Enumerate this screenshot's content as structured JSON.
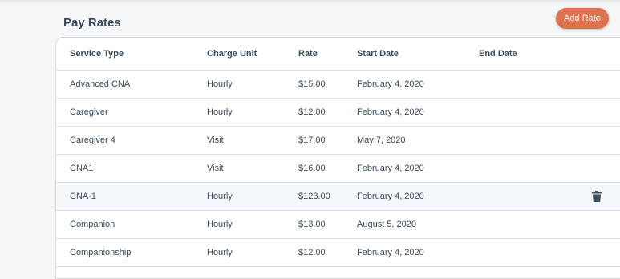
{
  "section": {
    "title": "Pay Rates",
    "add_button": "Add Rate"
  },
  "table": {
    "columns": [
      "Service Type",
      "Charge Unit",
      "Rate",
      "Start Date",
      "End Date"
    ],
    "rows": [
      {
        "service_type": "Advanced CNA",
        "charge_unit": "Hourly",
        "rate": "$15.00",
        "start_date": "February 4, 2020",
        "end_date": ""
      },
      {
        "service_type": "Caregiver",
        "charge_unit": "Hourly",
        "rate": "$12.00",
        "start_date": "February 4, 2020",
        "end_date": ""
      },
      {
        "service_type": "Caregiver 4",
        "charge_unit": "Visit",
        "rate": "$17.00",
        "start_date": "May 7, 2020",
        "end_date": ""
      },
      {
        "service_type": "CNA1",
        "charge_unit": "Visit",
        "rate": "$16.00",
        "start_date": "February 4, 2020",
        "end_date": ""
      },
      {
        "service_type": "CNA-1",
        "charge_unit": "Hourly",
        "rate": "$123.00",
        "start_date": "February 4, 2020",
        "end_date": "",
        "hovered": true,
        "action_icon": "trash-icon"
      },
      {
        "service_type": "Companion",
        "charge_unit": "Hourly",
        "rate": "$13.00",
        "start_date": "August 5, 2020",
        "end_date": ""
      },
      {
        "service_type": "Companionship",
        "charge_unit": "Hourly",
        "rate": "$12.00",
        "start_date": "February 4, 2020",
        "end_date": ""
      }
    ]
  },
  "colors": {
    "accent_button": "#e0714f",
    "title_text": "#3c4a5b",
    "hover_row": "#f3f7fa"
  }
}
